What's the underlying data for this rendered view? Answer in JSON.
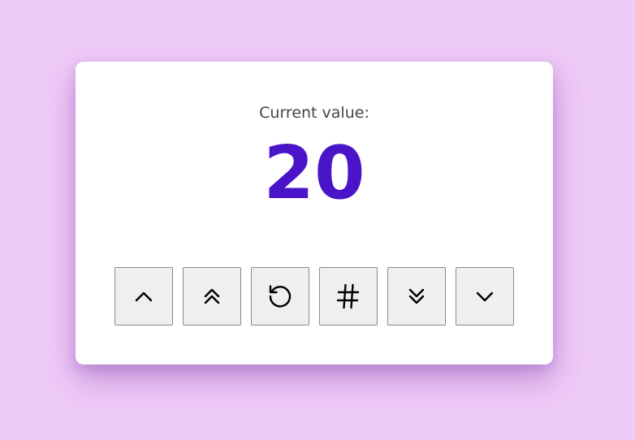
{
  "counter": {
    "label": "Current value:",
    "value": "20"
  },
  "controls": [
    {
      "icon": "chevron-up-icon",
      "name": "increment-button"
    },
    {
      "icon": "double-chevron-up-icon",
      "name": "increment-large-button"
    },
    {
      "icon": "reset-icon",
      "name": "reset-button"
    },
    {
      "icon": "hash-icon",
      "name": "set-value-button"
    },
    {
      "icon": "double-chevron-down-icon",
      "name": "decrement-large-button"
    },
    {
      "icon": "chevron-down-icon",
      "name": "decrement-button"
    }
  ],
  "colors": {
    "background": "#efcbf8",
    "card": "#ffffff",
    "value": "#4a14c8",
    "label": "#444444",
    "button": "#efefef"
  }
}
